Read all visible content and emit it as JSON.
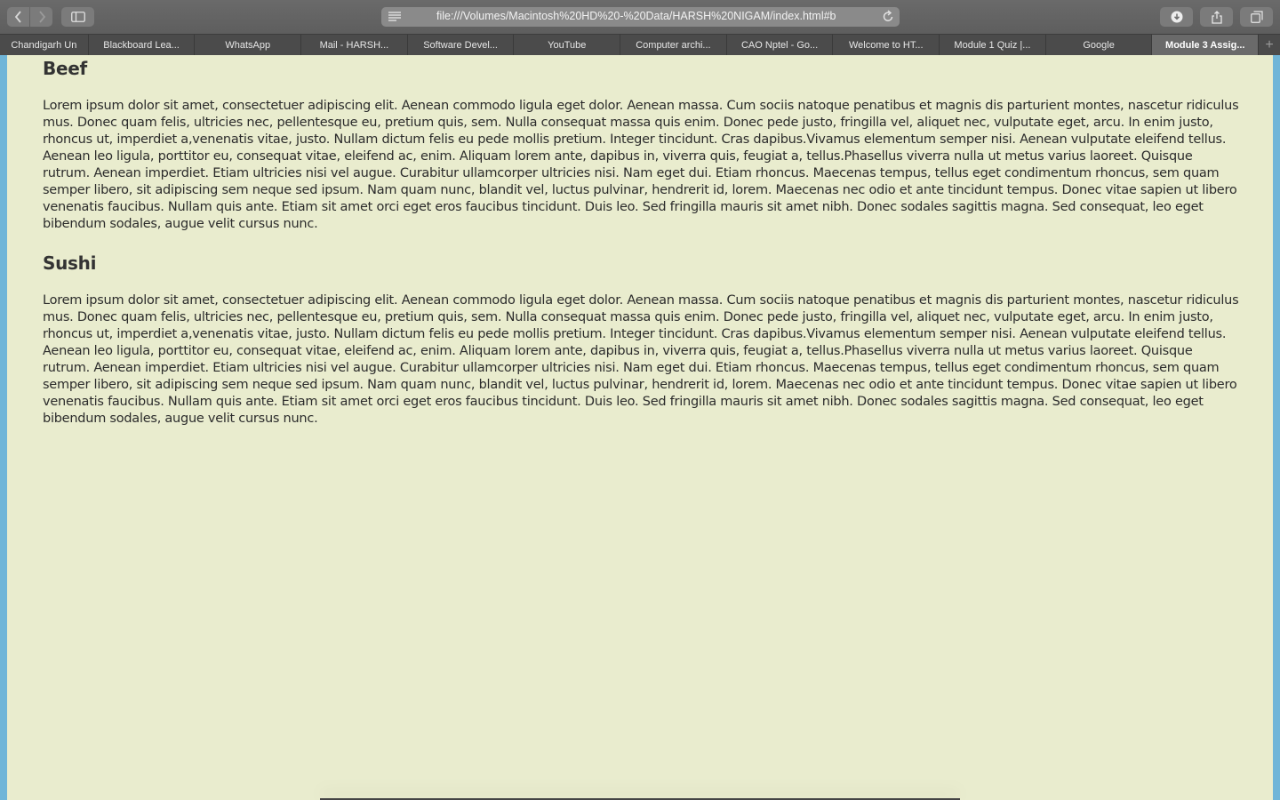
{
  "browser": {
    "url": "file:///Volumes/Macintosh%20HD%20-%20Data/HARSH%20NIGAM/index.html#b",
    "tabs": [
      {
        "label": "Chandigarh Un"
      },
      {
        "label": "Blackboard Lea..."
      },
      {
        "label": "WhatsApp"
      },
      {
        "label": "Mail - HARSH..."
      },
      {
        "label": "Software Devel..."
      },
      {
        "label": "YouTube"
      },
      {
        "label": "Computer archi..."
      },
      {
        "label": "CAO Nptel - Go..."
      },
      {
        "label": "Welcome to HT..."
      },
      {
        "label": "Module 1 Quiz |..."
      },
      {
        "label": "Google"
      },
      {
        "label": "Module 3 Assig..."
      }
    ],
    "new_tab_label": "+"
  },
  "page": {
    "sections": [
      {
        "title": "Beef",
        "body": "Lorem ipsum dolor sit amet, consectetuer adipiscing elit. Aenean commodo ligula eget dolor. Aenean massa. Cum sociis natoque penatibus et magnis dis parturient montes, nascetur ridiculus mus. Donec quam felis, ultricies nec, pellentesque eu, pretium quis, sem. Nulla consequat massa quis enim. Donec pede justo, fringilla vel, aliquet nec, vulputate eget, arcu. In enim justo, rhoncus ut, imperdiet a,venenatis vitae, justo. Nullam dictum felis eu pede mollis pretium. Integer tincidunt. Cras dapibus.Vivamus elementum semper nisi. Aenean vulputate eleifend tellus. Aenean leo ligula, porttitor eu, consequat vitae, eleifend ac, enim. Aliquam lorem ante, dapibus in, viverra quis, feugiat a, tellus.Phasellus viverra nulla ut metus varius laoreet. Quisque rutrum. Aenean imperdiet. Etiam ultricies nisi vel augue. Curabitur ullamcorper ultricies nisi. Nam eget dui. Etiam rhoncus. Maecenas tempus, tellus eget condimentum rhoncus, sem quam semper libero, sit adipiscing sem neque sed ipsum. Nam quam nunc, blandit vel, luctus pulvinar, hendrerit id, lorem. Maecenas nec odio et ante tincidunt tempus. Donec vitae sapien ut libero venenatis faucibus. Nullam quis ante. Etiam sit amet orci eget eros faucibus tincidunt. Duis leo. Sed fringilla mauris sit amet nibh. Donec sodales sagittis magna. Sed consequat, leo eget bibendum sodales, augue velit cursus nunc."
      },
      {
        "title": "Sushi",
        "body": "Lorem ipsum dolor sit amet, consectetuer adipiscing elit. Aenean commodo ligula eget dolor. Aenean massa. Cum sociis natoque penatibus et magnis dis parturient montes, nascetur ridiculus mus. Donec quam felis, ultricies nec, pellentesque eu, pretium quis, sem. Nulla consequat massa quis enim. Donec pede justo, fringilla vel, aliquet nec, vulputate eget, arcu. In enim justo, rhoncus ut, imperdiet a,venenatis vitae, justo. Nullam dictum felis eu pede mollis pretium. Integer tincidunt. Cras dapibus.Vivamus elementum semper nisi. Aenean vulputate eleifend tellus. Aenean leo ligula, porttitor eu, consequat vitae, eleifend ac, enim. Aliquam lorem ante, dapibus in, viverra quis, feugiat a, tellus.Phasellus viverra nulla ut metus varius laoreet. Quisque rutrum. Aenean imperdiet. Etiam ultricies nisi vel augue. Curabitur ullamcorper ultricies nisi. Nam eget dui. Etiam rhoncus. Maecenas tempus, tellus eget condimentum rhoncus, sem quam semper libero, sit adipiscing sem neque sed ipsum. Nam quam nunc, blandit vel, luctus pulvinar, hendrerit id, lorem. Maecenas nec odio et ante tincidunt tempus. Donec vitae sapien ut libero venenatis faucibus. Nullam quis ante. Etiam sit amet orci eget eros faucibus tincidunt. Duis leo. Sed fringilla mauris sit amet nibh. Donec sodales sagittis magna. Sed consequat, leo eget bibendum sodales, augue velit cursus nunc."
      }
    ]
  },
  "colors": {
    "page_background": "#e9ecce",
    "window_side_background": "#6fb5d8",
    "toolbar": "#636363",
    "tabbar": "#4b4b4b",
    "active_tab": "#6a6a6a"
  },
  "icons": [
    "back-icon",
    "forward-icon",
    "sidebar-icon",
    "reader-icon",
    "reload-icon",
    "download-icon",
    "share-icon",
    "tabs-overview-icon",
    "new-tab-icon"
  ]
}
